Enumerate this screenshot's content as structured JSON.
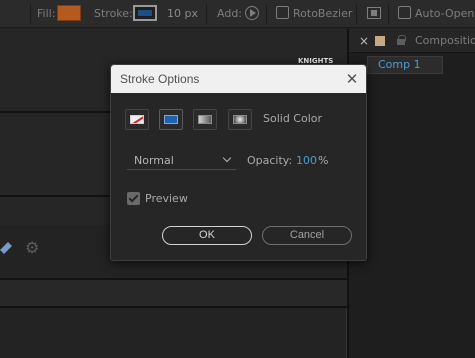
{
  "toolbar": {
    "fill_label": "Fill:",
    "fill_color": "#b5591f",
    "stroke_label": "Stroke:",
    "stroke_color": "#1c4f86",
    "stroke_width": "10 px",
    "add_label": "Add:",
    "rotobezier_label": "RotoBezier",
    "auto_open_label": "Auto-Open Pa"
  },
  "left_panel": {
    "thumbnail_text": "KNIGHTS"
  },
  "right_panel": {
    "title": "Composition",
    "tab_label": "Comp 1",
    "label_color": "#c8a982",
    "close_glyph": "×"
  },
  "dialog": {
    "title": "Stroke Options",
    "close_glyph": "✕",
    "stroke_types": [
      "none",
      "solid-color",
      "linear-gradient",
      "radial-gradient"
    ],
    "selected_type": "solid-color",
    "type_label": "Solid Color",
    "blend_mode": "Normal",
    "opacity_label": "Opacity:",
    "opacity_value": "100",
    "opacity_unit": "%",
    "preview_label": "Preview",
    "preview_checked": true,
    "ok_label": "OK",
    "cancel_label": "Cancel",
    "accent_color": "#4a9cd6"
  }
}
